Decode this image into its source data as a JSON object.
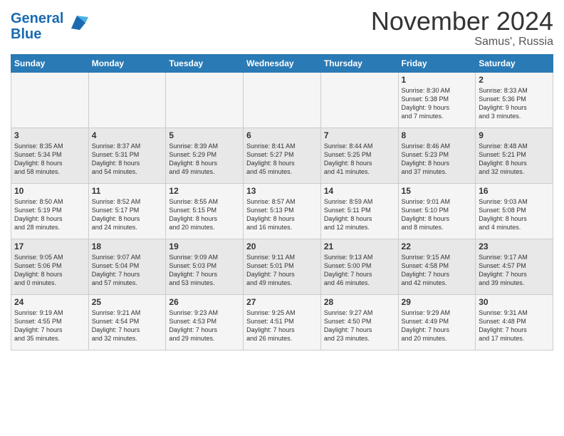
{
  "logo": {
    "line1": "General",
    "line2": "Blue"
  },
  "title": "November 2024",
  "subtitle": "Samus', Russia",
  "days_header": [
    "Sunday",
    "Monday",
    "Tuesday",
    "Wednesday",
    "Thursday",
    "Friday",
    "Saturday"
  ],
  "weeks": [
    [
      {
        "day": "",
        "info": ""
      },
      {
        "day": "",
        "info": ""
      },
      {
        "day": "",
        "info": ""
      },
      {
        "day": "",
        "info": ""
      },
      {
        "day": "",
        "info": ""
      },
      {
        "day": "1",
        "info": "Sunrise: 8:30 AM\nSunset: 5:38 PM\nDaylight: 9 hours\nand 7 minutes."
      },
      {
        "day": "2",
        "info": "Sunrise: 8:33 AM\nSunset: 5:36 PM\nDaylight: 9 hours\nand 3 minutes."
      }
    ],
    [
      {
        "day": "3",
        "info": "Sunrise: 8:35 AM\nSunset: 5:34 PM\nDaylight: 8 hours\nand 58 minutes."
      },
      {
        "day": "4",
        "info": "Sunrise: 8:37 AM\nSunset: 5:31 PM\nDaylight: 8 hours\nand 54 minutes."
      },
      {
        "day": "5",
        "info": "Sunrise: 8:39 AM\nSunset: 5:29 PM\nDaylight: 8 hours\nand 49 minutes."
      },
      {
        "day": "6",
        "info": "Sunrise: 8:41 AM\nSunset: 5:27 PM\nDaylight: 8 hours\nand 45 minutes."
      },
      {
        "day": "7",
        "info": "Sunrise: 8:44 AM\nSunset: 5:25 PM\nDaylight: 8 hours\nand 41 minutes."
      },
      {
        "day": "8",
        "info": "Sunrise: 8:46 AM\nSunset: 5:23 PM\nDaylight: 8 hours\nand 37 minutes."
      },
      {
        "day": "9",
        "info": "Sunrise: 8:48 AM\nSunset: 5:21 PM\nDaylight: 8 hours\nand 32 minutes."
      }
    ],
    [
      {
        "day": "10",
        "info": "Sunrise: 8:50 AM\nSunset: 5:19 PM\nDaylight: 8 hours\nand 28 minutes."
      },
      {
        "day": "11",
        "info": "Sunrise: 8:52 AM\nSunset: 5:17 PM\nDaylight: 8 hours\nand 24 minutes."
      },
      {
        "day": "12",
        "info": "Sunrise: 8:55 AM\nSunset: 5:15 PM\nDaylight: 8 hours\nand 20 minutes."
      },
      {
        "day": "13",
        "info": "Sunrise: 8:57 AM\nSunset: 5:13 PM\nDaylight: 8 hours\nand 16 minutes."
      },
      {
        "day": "14",
        "info": "Sunrise: 8:59 AM\nSunset: 5:11 PM\nDaylight: 8 hours\nand 12 minutes."
      },
      {
        "day": "15",
        "info": "Sunrise: 9:01 AM\nSunset: 5:10 PM\nDaylight: 8 hours\nand 8 minutes."
      },
      {
        "day": "16",
        "info": "Sunrise: 9:03 AM\nSunset: 5:08 PM\nDaylight: 8 hours\nand 4 minutes."
      }
    ],
    [
      {
        "day": "17",
        "info": "Sunrise: 9:05 AM\nSunset: 5:06 PM\nDaylight: 8 hours\nand 0 minutes."
      },
      {
        "day": "18",
        "info": "Sunrise: 9:07 AM\nSunset: 5:04 PM\nDaylight: 7 hours\nand 57 minutes."
      },
      {
        "day": "19",
        "info": "Sunrise: 9:09 AM\nSunset: 5:03 PM\nDaylight: 7 hours\nand 53 minutes."
      },
      {
        "day": "20",
        "info": "Sunrise: 9:11 AM\nSunset: 5:01 PM\nDaylight: 7 hours\nand 49 minutes."
      },
      {
        "day": "21",
        "info": "Sunrise: 9:13 AM\nSunset: 5:00 PM\nDaylight: 7 hours\nand 46 minutes."
      },
      {
        "day": "22",
        "info": "Sunrise: 9:15 AM\nSunset: 4:58 PM\nDaylight: 7 hours\nand 42 minutes."
      },
      {
        "day": "23",
        "info": "Sunrise: 9:17 AM\nSunset: 4:57 PM\nDaylight: 7 hours\nand 39 minutes."
      }
    ],
    [
      {
        "day": "24",
        "info": "Sunrise: 9:19 AM\nSunset: 4:55 PM\nDaylight: 7 hours\nand 35 minutes."
      },
      {
        "day": "25",
        "info": "Sunrise: 9:21 AM\nSunset: 4:54 PM\nDaylight: 7 hours\nand 32 minutes."
      },
      {
        "day": "26",
        "info": "Sunrise: 9:23 AM\nSunset: 4:53 PM\nDaylight: 7 hours\nand 29 minutes."
      },
      {
        "day": "27",
        "info": "Sunrise: 9:25 AM\nSunset: 4:51 PM\nDaylight: 7 hours\nand 26 minutes."
      },
      {
        "day": "28",
        "info": "Sunrise: 9:27 AM\nSunset: 4:50 PM\nDaylight: 7 hours\nand 23 minutes."
      },
      {
        "day": "29",
        "info": "Sunrise: 9:29 AM\nSunset: 4:49 PM\nDaylight: 7 hours\nand 20 minutes."
      },
      {
        "day": "30",
        "info": "Sunrise: 9:31 AM\nSunset: 4:48 PM\nDaylight: 7 hours\nand 17 minutes."
      }
    ]
  ]
}
